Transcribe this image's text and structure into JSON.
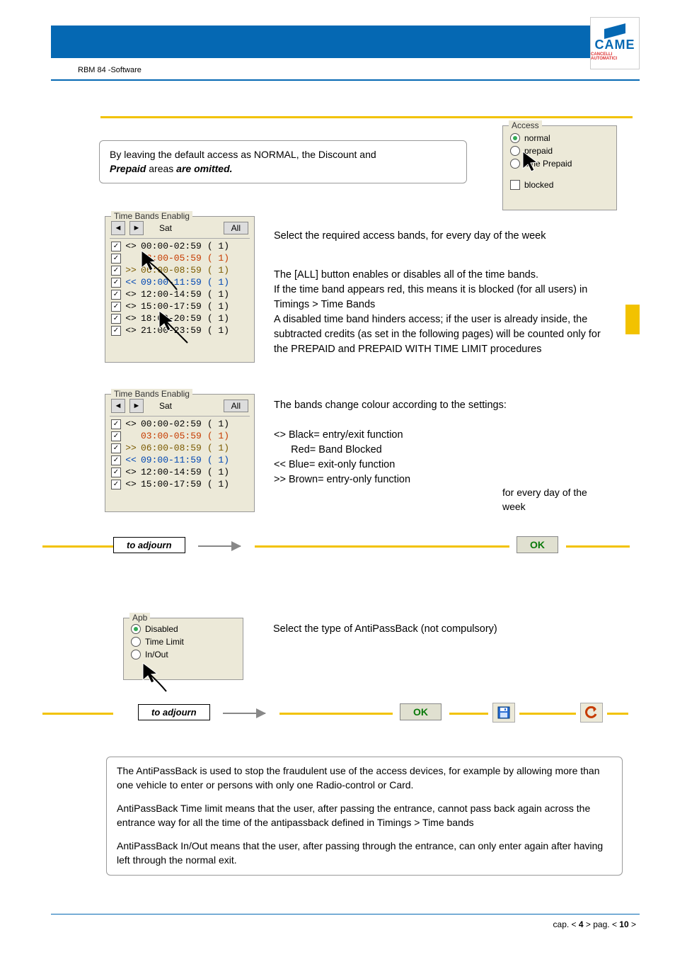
{
  "header": {
    "doc_label": "RBM 84 -Software"
  },
  "logo": {
    "text": "CAME",
    "subtitle": "CANCELLI AUTOMATICI"
  },
  "info_box1": {
    "line1": "By leaving the default access as NORMAL, the Discount and ",
    "line2a": "Prepaid",
    "line2b": " areas ",
    "line2c": "are omitted."
  },
  "access_panel": {
    "title": "Access",
    "options": [
      "normal",
      "prepaid",
      "time Prepaid"
    ],
    "blocked_label": "blocked"
  },
  "timebands1": {
    "title": "Time Bands Enablig",
    "day": "Sat",
    "all": "All",
    "rows": [
      {
        "chk": true,
        "sym": "<>",
        "time": "00:00-02:59",
        "paren": "(   1)",
        "color": "c-black"
      },
      {
        "chk": true,
        "sym": "",
        "time": "03:00-05:59",
        "paren": "(   1)",
        "color": "c-red"
      },
      {
        "chk": true,
        "sym": ">>",
        "time": "06:00-08:59",
        "paren": "(   1)",
        "color": "c-brown"
      },
      {
        "chk": true,
        "sym": "<<",
        "time": "09:00-11:59",
        "paren": "(   1)",
        "color": "c-blue"
      },
      {
        "chk": true,
        "sym": "<>",
        "time": "12:00-14:59",
        "paren": "(   1)",
        "color": "c-black"
      },
      {
        "chk": true,
        "sym": "<>",
        "time": "15:00-17:59",
        "paren": "(   1)",
        "color": "c-black"
      },
      {
        "chk": true,
        "sym": "<>",
        "time": "18:00-20:59",
        "paren": "(   1)",
        "color": "c-black"
      },
      {
        "chk": true,
        "sym": "<>",
        "time": "21:00-23:59",
        "paren": "(   1)",
        "color": "c-black"
      }
    ]
  },
  "section1_text": {
    "p1": "Select the required access bands, for every day of the week",
    "p2": "  The [ALL] button  enables or disables all of the time bands.\nIf the time band appears red, this means it is blocked (for all users) in Timings > Time Bands\nA disabled time band hinders access; if the user is already inside, the subtracted credits (as set in the following pages) will be counted only for the PREPAID and PREPAID WITH TIME LIMIT procedures"
  },
  "timebands2": {
    "title": "Time Bands Enablig",
    "day": "Sat",
    "all": "All",
    "rows": [
      {
        "chk": true,
        "sym": "<>",
        "time": "00:00-02:59",
        "paren": "(   1)",
        "color": "c-black"
      },
      {
        "chk": true,
        "sym": "",
        "time": "03:00-05:59",
        "paren": "(   1)",
        "color": "c-red"
      },
      {
        "chk": true,
        "sym": ">>",
        "time": "06:00-08:59",
        "paren": "(   1)",
        "color": "c-brown"
      },
      {
        "chk": true,
        "sym": "<<",
        "time": "09:00-11:59",
        "paren": "(   1)",
        "color": "c-blue"
      },
      {
        "chk": true,
        "sym": "<>",
        "time": "12:00-14:59",
        "paren": "(   1)",
        "color": "c-black"
      },
      {
        "chk": true,
        "sym": "<>",
        "time": "15:00-17:59",
        "paren": "(   1)",
        "color": "c-black"
      }
    ]
  },
  "legend": {
    "p1": "The bands change colour according to the settings:",
    "l1": "<> Black= entry/exit function",
    "l2": "      Red= Band Blocked",
    "l3": "<< Blue= exit-only function",
    "l4": ">> Brown= entry-only function",
    "side_note": "for every day of the week"
  },
  "adjourn_label": "to adjourn",
  "ok_label": "OK",
  "apb": {
    "title": "Apb",
    "options": [
      "Disabled",
      "Time Limit",
      "In/Out"
    ],
    "heading": "Select the type of AntiPassBack (not compulsory)"
  },
  "bottom_info": {
    "p1": "The AntiPassBack is used to stop the fraudulent use of the access devices, for example by allowing more than one vehicle to enter or persons with only one Radio-control or Card.",
    "p2": "AntiPassBack Time limit means that the user, after passing the entrance, cannot pass back again across the entrance way for all the time of the antipassback defined in Timings > Time bands",
    "p3": "AntiPassBack In/Out means that the user, after passing through the entrance, can  only enter again after having left through the normal exit."
  },
  "footer": {
    "text_a": "cap. < ",
    "text_b": "4",
    "text_c": " > pag. < ",
    "text_d": "10",
    "text_e": " >"
  }
}
